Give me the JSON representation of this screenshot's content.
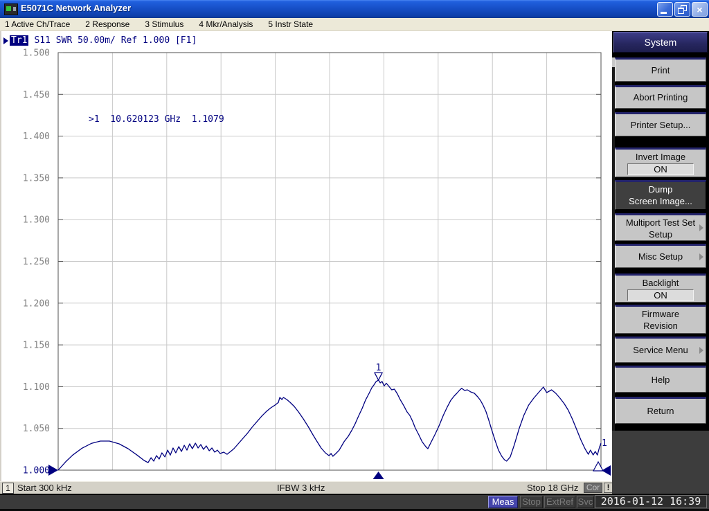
{
  "window": {
    "title": "E5071C Network Analyzer",
    "controls": {
      "minimize": "minimize",
      "restore": "restore",
      "close": "close"
    }
  },
  "menu_bar": {
    "items": [
      "1 Active Ch/Trace",
      "2 Response",
      "3 Stimulus",
      "4 Mkr/Analysis",
      "5 Instr State"
    ]
  },
  "trace_status": {
    "active_trace": "Tr1",
    "text": "S11 SWR 50.00m/ Ref 1.000 [F1]"
  },
  "marker_readout": {
    "text": ">1  10.620123 GHz  1.1079"
  },
  "softkeys": {
    "header": "System",
    "buttons": [
      {
        "lines": [
          "Print"
        ]
      },
      {
        "lines": [
          "Abort Printing"
        ]
      },
      {
        "lines": [
          "Printer Setup..."
        ]
      },
      {
        "lines": [
          "Invert Image"
        ],
        "toggle": "ON"
      },
      {
        "lines": [
          "Dump",
          "Screen Image..."
        ],
        "selected": true
      },
      {
        "lines": [
          "Multiport Test Set",
          "Setup"
        ],
        "submenu": true
      },
      {
        "lines": [
          "Misc Setup"
        ],
        "submenu": true
      },
      {
        "lines": [
          "Backlight"
        ],
        "toggle": "ON"
      },
      {
        "lines": [
          "Firmware",
          "Revision"
        ]
      },
      {
        "lines": [
          "Service Menu"
        ],
        "submenu": true
      },
      {
        "lines": [
          "Help"
        ]
      },
      {
        "lines": [
          "Return"
        ]
      }
    ]
  },
  "channel_bar": {
    "channel": "1",
    "start": "Start 300 kHz",
    "ifbw": "IFBW 3 kHz",
    "stop": "Stop 18 GHz",
    "correction": "Cor",
    "alert": "!"
  },
  "status_bar": {
    "items": [
      {
        "label": "Meas",
        "active": true
      },
      {
        "label": "Stop",
        "active": false
      },
      {
        "label": "ExtRef",
        "active": false
      },
      {
        "label": "Svc",
        "active": false
      }
    ],
    "datetime": "2016-01-12 16:39"
  },
  "chart_data": {
    "type": "line",
    "title": "",
    "x_axis": {
      "start_label": "Start 300 kHz",
      "stop_label": "Stop 18 GHz",
      "unit": "GHz",
      "range_ghz": [
        0.0003,
        18
      ],
      "divisions": 10,
      "tick_labels_visible": false
    },
    "y_axis": {
      "quantity": "SWR",
      "scale_per_division": 0.05,
      "reference_level": "1.000",
      "range": [
        1.0,
        1.5
      ],
      "ticks": [
        "1.500",
        "1.450",
        "1.400",
        "1.350",
        "1.300",
        "1.250",
        "1.200",
        "1.150",
        "1.100",
        "1.050",
        "1.000"
      ]
    },
    "grid": true,
    "trace_color": "#000080",
    "grid_color": "#C9C9C9",
    "markers": [
      {
        "id": "1",
        "freq_ghz": 10.620123,
        "value": 1.1079,
        "readout": ">1  10.620123 GHz  1.1079"
      }
    ],
    "trace_end_label": "1",
    "series": [
      {
        "name": "Tr1 S11 SWR",
        "points_ghz_swr": [
          [
            0.0,
            1.0
          ],
          [
            0.25,
            1.01
          ],
          [
            0.48,
            1.018
          ],
          [
            0.78,
            1.026
          ],
          [
            1.1,
            1.032
          ],
          [
            1.4,
            1.0348
          ],
          [
            1.7,
            1.0348
          ],
          [
            2.02,
            1.0315
          ],
          [
            2.32,
            1.0257
          ],
          [
            2.62,
            1.018
          ],
          [
            2.85,
            1.0116
          ],
          [
            2.98,
            1.009
          ],
          [
            3.08,
            1.0149
          ],
          [
            3.17,
            1.0108
          ],
          [
            3.26,
            1.0174
          ],
          [
            3.35,
            1.0133
          ],
          [
            3.44,
            1.0207
          ],
          [
            3.54,
            1.0158
          ],
          [
            3.63,
            1.024
          ],
          [
            3.72,
            1.018
          ],
          [
            3.81,
            1.0265
          ],
          [
            3.9,
            1.0207
          ],
          [
            4.0,
            1.0282
          ],
          [
            4.09,
            1.0224
          ],
          [
            4.18,
            1.0298
          ],
          [
            4.27,
            1.024
          ],
          [
            4.36,
            1.0315
          ],
          [
            4.45,
            1.0257
          ],
          [
            4.55,
            1.0323
          ],
          [
            4.64,
            1.0265
          ],
          [
            4.73,
            1.0307
          ],
          [
            4.82,
            1.0249
          ],
          [
            4.91,
            1.029
          ],
          [
            5.01,
            1.0232
          ],
          [
            5.1,
            1.0265
          ],
          [
            5.19,
            1.0216
          ],
          [
            5.28,
            1.024
          ],
          [
            5.37,
            1.0199
          ],
          [
            5.49,
            1.0216
          ],
          [
            5.6,
            1.019
          ],
          [
            5.72,
            1.0224
          ],
          [
            5.83,
            1.0257
          ],
          [
            5.97,
            1.0315
          ],
          [
            6.11,
            1.0373
          ],
          [
            6.27,
            1.0439
          ],
          [
            6.43,
            1.0514
          ],
          [
            6.59,
            1.058
          ],
          [
            6.75,
            1.0647
          ],
          [
            6.91,
            1.0705
          ],
          [
            7.05,
            1.0746
          ],
          [
            7.19,
            1.0779
          ],
          [
            7.3,
            1.081
          ],
          [
            7.35,
            1.0871
          ],
          [
            7.42,
            1.0846
          ],
          [
            7.47,
            1.0871
          ],
          [
            7.58,
            1.0846
          ],
          [
            7.69,
            1.0813
          ],
          [
            7.83,
            1.0763
          ],
          [
            7.97,
            1.0697
          ],
          [
            8.13,
            1.0614
          ],
          [
            8.29,
            1.0522
          ],
          [
            8.45,
            1.0423
          ],
          [
            8.59,
            1.034
          ],
          [
            8.72,
            1.0265
          ],
          [
            8.86,
            1.0207
          ],
          [
            8.98,
            1.0174
          ],
          [
            9.05,
            1.0199
          ],
          [
            9.11,
            1.0166
          ],
          [
            9.21,
            1.0199
          ],
          [
            9.32,
            1.024
          ],
          [
            9.48,
            1.034
          ],
          [
            9.62,
            1.0406
          ],
          [
            9.73,
            1.0473
          ],
          [
            9.85,
            1.0556
          ],
          [
            9.96,
            1.0647
          ],
          [
            10.08,
            1.0738
          ],
          [
            10.19,
            1.0837
          ],
          [
            10.31,
            1.092
          ],
          [
            10.4,
            1.0987
          ],
          [
            10.47,
            1.102
          ],
          [
            10.54,
            1.106
          ],
          [
            10.62,
            1.1079
          ],
          [
            10.68,
            1.1045
          ],
          [
            10.74,
            1.1062
          ],
          [
            10.81,
            1.1008
          ],
          [
            10.88,
            1.1041
          ],
          [
            10.97,
            1.1003
          ],
          [
            11.06,
            1.0962
          ],
          [
            11.15,
            1.097
          ],
          [
            11.25,
            1.0912
          ],
          [
            11.34,
            1.0846
          ],
          [
            11.45,
            1.0779
          ],
          [
            11.57,
            1.0697
          ],
          [
            11.66,
            1.0655
          ],
          [
            11.75,
            1.0588
          ],
          [
            11.84,
            1.0506
          ],
          [
            11.96,
            1.0423
          ],
          [
            12.07,
            1.034
          ],
          [
            12.19,
            1.0282
          ],
          [
            12.26,
            1.0257
          ],
          [
            12.35,
            1.0323
          ],
          [
            12.49,
            1.0423
          ],
          [
            12.63,
            1.0531
          ],
          [
            12.77,
            1.0655
          ],
          [
            12.9,
            1.0755
          ],
          [
            13.02,
            1.0837
          ],
          [
            13.13,
            1.0887
          ],
          [
            13.22,
            1.092
          ],
          [
            13.32,
            1.0962
          ],
          [
            13.38,
            1.0979
          ],
          [
            13.48,
            1.0954
          ],
          [
            13.57,
            1.0962
          ],
          [
            13.68,
            1.0937
          ],
          [
            13.8,
            1.092
          ],
          [
            13.91,
            1.0879
          ],
          [
            14.0,
            1.0837
          ],
          [
            14.09,
            1.0779
          ],
          [
            14.19,
            1.0697
          ],
          [
            14.28,
            1.0597
          ],
          [
            14.37,
            1.049
          ],
          [
            14.48,
            1.0365
          ],
          [
            14.6,
            1.024
          ],
          [
            14.71,
            1.0166
          ],
          [
            14.8,
            1.0124
          ],
          [
            14.87,
            1.0108
          ],
          [
            14.99,
            1.0158
          ],
          [
            15.12,
            1.0298
          ],
          [
            15.28,
            1.049
          ],
          [
            15.44,
            1.0655
          ],
          [
            15.6,
            1.0779
          ],
          [
            15.77,
            1.0862
          ],
          [
            15.93,
            1.0929
          ],
          [
            16.09,
            1.0995
          ],
          [
            16.2,
            1.0929
          ],
          [
            16.36,
            1.0962
          ],
          [
            16.5,
            1.092
          ],
          [
            16.64,
            1.0862
          ],
          [
            16.78,
            1.0796
          ],
          [
            16.91,
            1.0721
          ],
          [
            17.05,
            1.0614
          ],
          [
            17.19,
            1.049
          ],
          [
            17.33,
            1.0365
          ],
          [
            17.47,
            1.0257
          ],
          [
            17.58,
            1.019
          ],
          [
            17.65,
            1.024
          ],
          [
            17.74,
            1.0182
          ],
          [
            17.81,
            1.0224
          ],
          [
            17.88,
            1.0182
          ],
          [
            17.95,
            1.0274
          ],
          [
            18.0,
            1.0323
          ]
        ]
      }
    ]
  }
}
